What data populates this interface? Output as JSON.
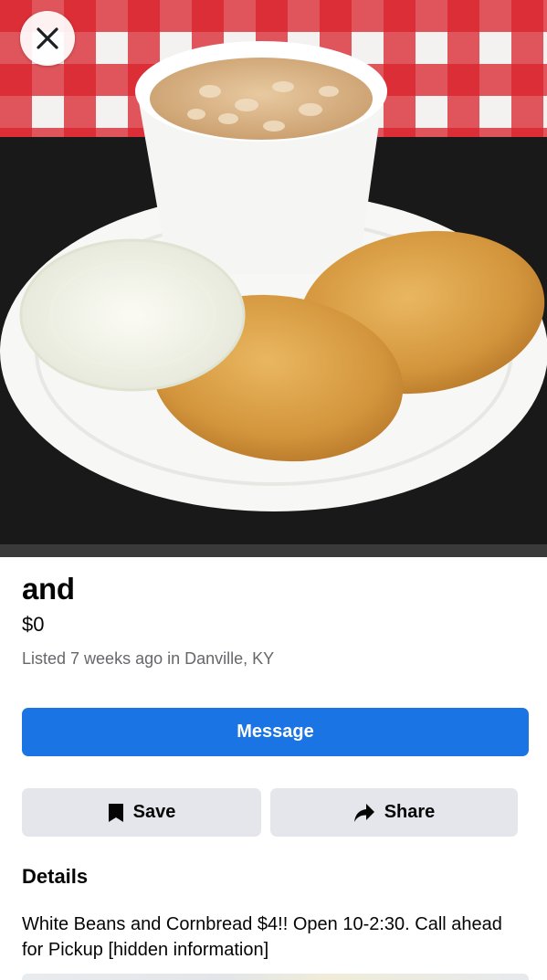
{
  "photo": {
    "alt_icon": "close-icon"
  },
  "listing": {
    "title": "and",
    "price": "$0",
    "meta": "Listed 7 weeks ago in Danville, KY"
  },
  "actions": {
    "message_label": "Message",
    "save_label": "Save",
    "save_icon": "bookmark-icon",
    "share_label": "Share",
    "share_icon": "share-arrow-icon"
  },
  "details": {
    "heading": "Details",
    "description": "White Beans and Cornbread $4!! Open 10-2:30. Call ahead for Pickup [hidden information]"
  },
  "colors": {
    "primary": "#1b74e4",
    "secondary_button": "#e4e6eb",
    "meta_text": "#65676b"
  }
}
